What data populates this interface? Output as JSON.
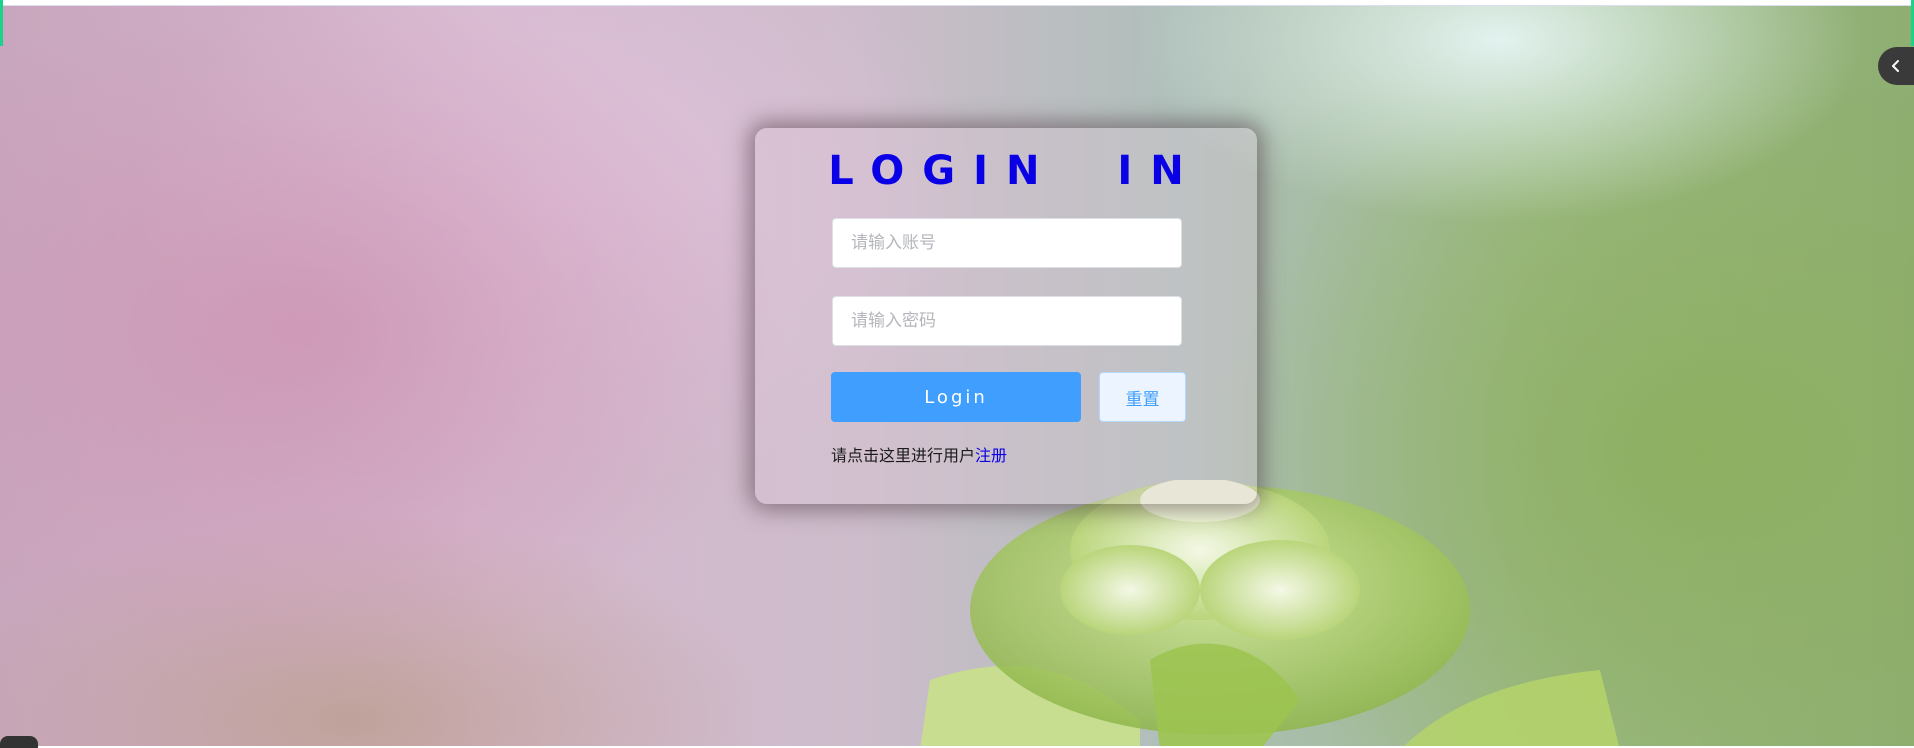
{
  "login": {
    "title": "LOGIN IN",
    "account_placeholder": "请输入账号",
    "password_placeholder": "请输入密码",
    "login_button": "Login",
    "reset_button": "重置",
    "register_prompt": "请点击这里进行用户",
    "register_link": "注册"
  },
  "icons": {
    "sidebar_toggle": "chevron-left-icon"
  },
  "colors": {
    "title": "#0a00e6",
    "primary": "#409eff",
    "reset_bg": "#ecf5ff",
    "accent": "#18d48a"
  }
}
